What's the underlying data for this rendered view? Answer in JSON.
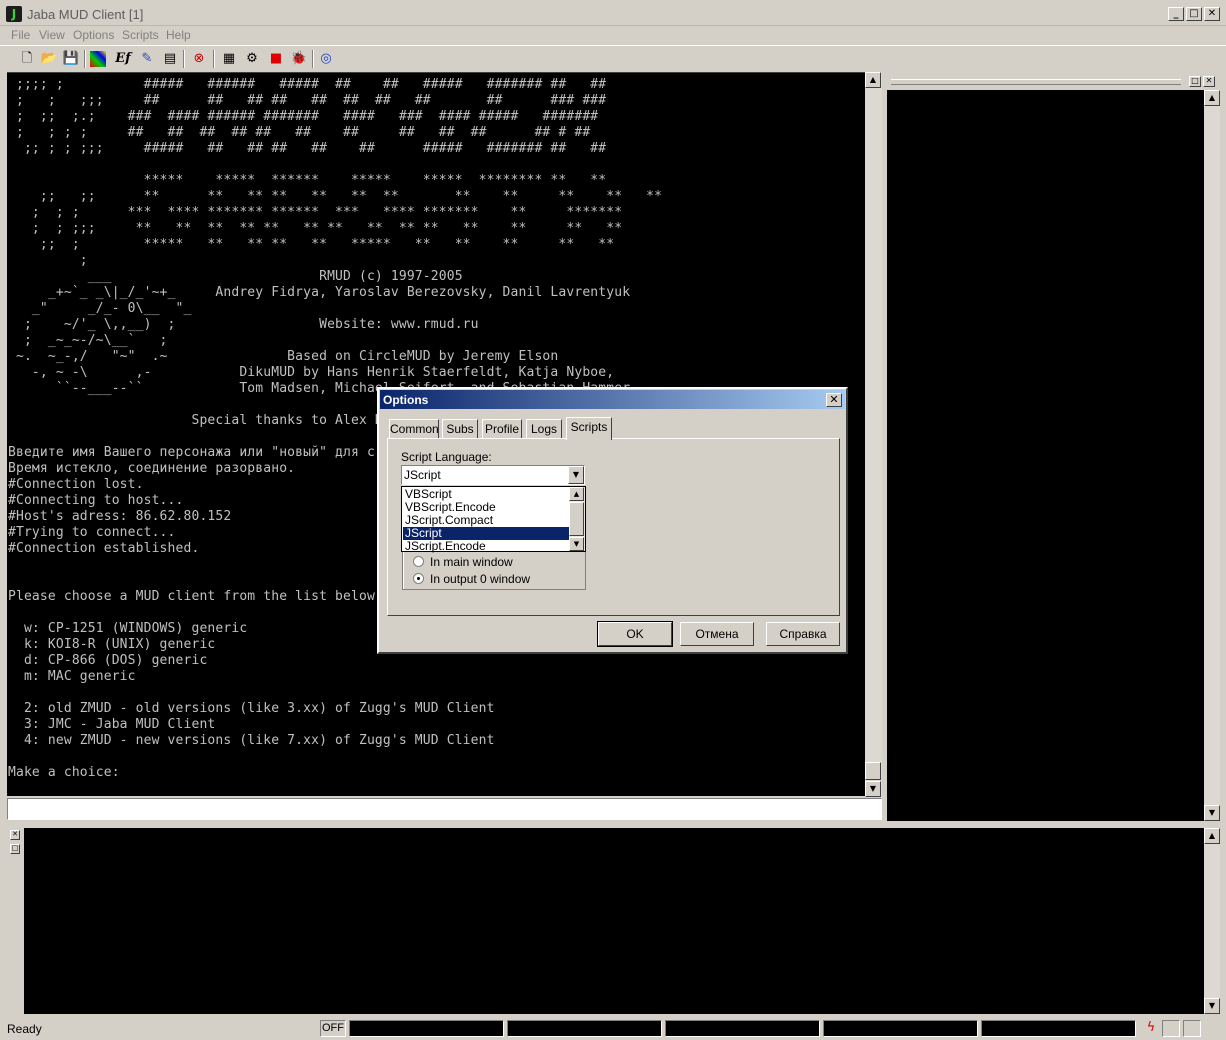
{
  "window": {
    "title": "Jaba MUD Client [1]",
    "minimize_glyph": "_",
    "maximize_glyph": "□",
    "close_glyph": "✕"
  },
  "menu": [
    "File",
    "View",
    "Options",
    "Scripts",
    "Help"
  ],
  "toolbar": {
    "icons": [
      "new-icon",
      "open-icon",
      "save-icon",
      "colors-icon",
      "font-icon",
      "tools-icon",
      "window-icon",
      "disconnect-icon",
      "log-icon",
      "settings-icon",
      "stop-icon",
      "bug-icon",
      "help-icon"
    ]
  },
  "terminal": {
    "lines": [
      " ;;;; ;          #####   ######   #####  ##    ##   #####   ####### ##   ##",
      " ;   ;   ;;;     ##      ##   ## ##   ##  ##  ##   ##       ##      ### ###",
      " ;  ;;  ;.;    ###  #### ###### #######   ####   ###  #### #####   #######",
      " ;   ; ; ;     ##   ##  ##  ## ##   ##    ##     ##   ##  ##      ## # ##",
      "  ;; ; ; ;;;     #####   ##   ## ##   ##    ##      #####   ####### ##   ##",
      "",
      "                 *****    *****  ******    *****    *****  ******** **   **",
      "    ;;   ;;      **      **   ** **   **   **  **       **    **     **    **   **",
      "   ;  ; ;      ***  **** ******* ******  ***   **** *******    **     *******",
      "   ;  ; ;;;     **   **  **  ** **   ** **   **  ** **   **    **     **   **",
      "    ;;  ;        *****   **   ** **   **   *****   **   **    **     **   **",
      "         ;",
      "          ___                          RMUD (c) 1997-2005",
      "     _+~`_ _\\|_/_'~+_     Andrey Fidrya, Yaroslav Berezovsky, Danil Lavrentyuk",
      "   _\"     _/_- 0\\__  \"_",
      "  ;    ~/'_ \\,,__)  ;                  Website: www.rmud.ru",
      "  ;  _~_~-/~\\__`   ;",
      " ~.  ~_-,/   \"~\"  .~               Based on CircleMUD by Jeremy Elson",
      "   -, ~ -\\      ,-           DikuMUD by Hans Henrik Staerfeldt, Katja Nyboe,",
      "      ``--___--``            Tom Madsen, Michael Seifert, and Sebastian Hammer",
      "",
      "                       Special thanks to Alex K",
      "",
      "Введите имя Вашего персонажа или \"новый\" для с",
      "Время истекло, соединение разорвано.",
      "#Connection lost.",
      "#Connecting to host...",
      "#Host's adress: 86.62.80.152",
      "#Trying to connect...",
      "#Connection established.",
      "",
      "",
      "Please choose a MUD client from the list below",
      "",
      "  w: CP-1251 (WINDOWS) generic",
      "  k: KOI8-R (UNIX) generic",
      "  d: CP-866 (DOS) generic",
      "  m: MAC generic",
      "",
      "  2: old ZMUD - old versions (like 3.xx) of Zugg's MUD Client",
      "  3: JMC - Jaba MUD Client",
      "  4: new ZMUD - new versions (like 7.xx) of Zugg's MUD Client",
      "",
      "Make a choice:"
    ]
  },
  "command_input": {
    "value": ""
  },
  "status": {
    "ready": "Ready",
    "off": "OFF"
  },
  "dialog": {
    "title": "Options",
    "tabs": [
      "Common",
      "Subs",
      "Profile",
      "Logs",
      "Scripts"
    ],
    "active_tab": "Scripts",
    "script_language_label": "Script Language:",
    "selected_language": "JScript",
    "options": [
      "VBScript",
      "VBScript.Encode",
      "JScript.Compact",
      "JScript",
      "JScript.Encode"
    ],
    "radio_main": "In main window",
    "radio_output": "In output 0 window",
    "ok": "OK",
    "cancel": "Отмена",
    "help": "Справка"
  },
  "colors": {
    "terminal_bg": "#000000",
    "terminal_text": "#c0c0c0",
    "title_gradient_start": "#0a246a",
    "title_gradient_end": "#a6caf0",
    "selection": "#0a246a"
  }
}
